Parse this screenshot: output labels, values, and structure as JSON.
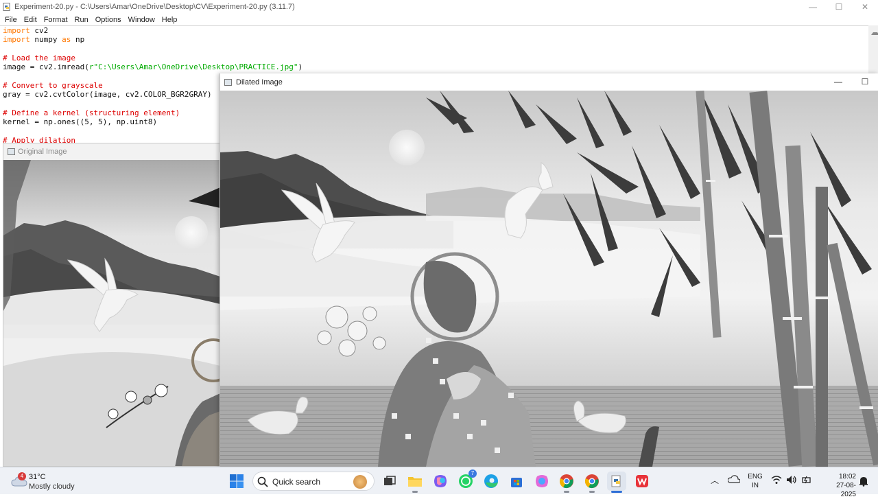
{
  "idle": {
    "title": "Experiment-20.py - C:\\Users\\Amar\\OneDrive\\Desktop\\CV\\Experiment-20.py (3.11.7)",
    "menu": [
      "File",
      "Edit",
      "Format",
      "Run",
      "Options",
      "Window",
      "Help"
    ],
    "controls": {
      "minimize": "—",
      "maximize": "☐",
      "close": "✕"
    },
    "code": {
      "l1_kw": "import",
      "l1_rest": " cv2",
      "l2_kw": "import",
      "l2_mid": " numpy ",
      "l2_kw2": "as",
      "l2_rest": " np",
      "l4_cm": "# Load the image",
      "l5_pre": "image = cv2.imread(",
      "l5_str": "r\"C:\\Users\\Amar\\OneDrive\\Desktop\\PRACTICE.jpg\"",
      "l5_post": ")",
      "l7_cm": "# Convert to grayscale",
      "l8": "gray = cv2.cvtColor(image, cv2.COLOR_BGR2GRAY)",
      "l10_cm": "# Define a kernel (structuring element)",
      "l11": "kernel = np.ones((5, 5), np.uint8)",
      "l13_cm": "# Apply dilation"
    }
  },
  "original_window": {
    "title": "Original Image"
  },
  "dilated_window": {
    "title": "Dilated Image",
    "minimize": "—",
    "maximize": "☐"
  },
  "taskbar": {
    "weather": {
      "badge": "4",
      "temp": "31°C",
      "condition": "Mostly cloudy"
    },
    "search_placeholder": "Quick search",
    "whatsapp_badge": "7",
    "language": {
      "line1": "ENG",
      "line2": "IN"
    },
    "clock": {
      "time": "18:02",
      "date": "27-08-2025"
    }
  }
}
